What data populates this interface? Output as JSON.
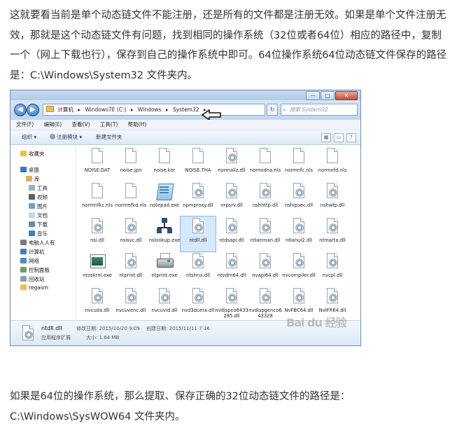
{
  "article": {
    "para1": "这就要看当前是单个动态链文件不能注册，还是所有的文件都是注册无效。如果是单个文件注册无效，那就是这个动态链文件有问题，找到相同的操作系统（32位或者64位）相应的路径中，复制一个（网上下载也行），保存到自己的操作系统中即可。64位操作系统64位动态链文件保存的路径是：C:\\Windows\\System32 文件夹内。",
    "para2": "如果是64位的操作系统，那么提取、保存正确的32位动态链文件的路径是：C:\\Windows\\SysWOW64 文件夹内。"
  },
  "explorer": {
    "window_buttons": [
      "—",
      "□",
      "✕"
    ],
    "nav": {
      "back": "◀",
      "forward": "▶"
    },
    "address": [
      "计算机",
      "▸",
      "Windows7E (C:)",
      "▸",
      "Windows",
      "▸",
      "System32",
      "▸"
    ],
    "refresh_symbol": "↻",
    "search_placeholder": "搜索 System32",
    "search_icon": "⌕",
    "menu": [
      "文件(F)",
      "编辑(E)",
      "查看(V)",
      "工具(T)",
      "帮助(H)"
    ],
    "commands": {
      "organize": "组织 ▾",
      "register": "注册模块 ▾",
      "new_folder": "新建文件夹"
    },
    "view_icons": [
      "▦",
      "▭",
      "?"
    ],
    "sidebar": [
      {
        "label": "收藏夹",
        "color": "#f0c040"
      },
      {
        "label": "桌面",
        "color": "#3a78c0"
      },
      {
        "label": "库",
        "color": "#d9b25c"
      },
      {
        "label": "工具",
        "color": "#9ab0c8"
      },
      {
        "label": "视频",
        "color": "#555e6a"
      },
      {
        "label": "图片",
        "color": "#6ea0d0"
      },
      {
        "label": "文档",
        "color": "#c8d4e0"
      },
      {
        "label": "下载",
        "color": "#5c8cc8"
      },
      {
        "label": "音乐",
        "color": "#3f7cc8"
      },
      {
        "label": "电脑人人有",
        "color": "#7a7a7a"
      },
      {
        "label": "计算机",
        "color": "#4a7cb8"
      },
      {
        "label": "网络",
        "color": "#4a8ad0"
      },
      {
        "label": "控制面板",
        "color": "#6ba060"
      },
      {
        "label": "回收站",
        "color": "#8aa0b4"
      },
      {
        "label": "regasm",
        "color": "#e8c060"
      }
    ],
    "files": [
      {
        "name": "NOISE.DAT",
        "kind": "page"
      },
      {
        "name": "noise.jpn",
        "kind": "page"
      },
      {
        "name": "noise.kor",
        "kind": "page"
      },
      {
        "name": "NOISE.THA",
        "kind": "page"
      },
      {
        "name": "normaliz.dll",
        "kind": "dll"
      },
      {
        "name": "normidna.nls",
        "kind": "page"
      },
      {
        "name": "normnfc.nls",
        "kind": "page"
      },
      {
        "name": "normnfd.nls",
        "kind": "page"
      },
      {
        "name": "normnfkc.nls",
        "kind": "page"
      },
      {
        "name": "normnfkd.nls",
        "kind": "page"
      },
      {
        "name": "notepad.exe",
        "kind": "notepad"
      },
      {
        "name": "npmproxy.dll",
        "kind": "dll"
      },
      {
        "name": "nrpsrv.dll",
        "kind": "dll"
      },
      {
        "name": "nshhttp.dll",
        "kind": "dll"
      },
      {
        "name": "nshipsec.dll",
        "kind": "dll"
      },
      {
        "name": "nshwfp.dll",
        "kind": "dll"
      },
      {
        "name": "nsi.dll",
        "kind": "dll"
      },
      {
        "name": "nsisvc.dll",
        "kind": "dll"
      },
      {
        "name": "nslookup.exe",
        "kind": "network"
      },
      {
        "name": "ntdll.dll",
        "kind": "dll",
        "selected": true
      },
      {
        "name": "ntdsapi.dll",
        "kind": "dll"
      },
      {
        "name": "ntlanman.dll",
        "kind": "dll"
      },
      {
        "name": "ntlanui2.dll",
        "kind": "dll"
      },
      {
        "name": "ntmarta.dll",
        "kind": "dll"
      },
      {
        "name": "ntoskrnl.exe",
        "kind": "app"
      },
      {
        "name": "ntprint.dll",
        "kind": "dll"
      },
      {
        "name": "ntprint.exe",
        "kind": "printer"
      },
      {
        "name": "ntshrui.dll",
        "kind": "dll"
      },
      {
        "name": "ntvdm64.dll",
        "kind": "dll"
      },
      {
        "name": "nvapi64.dll",
        "kind": "dll"
      },
      {
        "name": "nvcompiler.dll",
        "kind": "dll"
      },
      {
        "name": "nvcpl.dll",
        "kind": "dll"
      },
      {
        "name": "nvcuda.dll",
        "kind": "dll"
      },
      {
        "name": "nvcuvenc.dll",
        "kind": "dll"
      },
      {
        "name": "nvcuvid.dll",
        "kind": "dll"
      },
      {
        "name": "nvd3dumx.dll",
        "kind": "dll"
      },
      {
        "name": "nvdispco6433285.dll",
        "kind": "dll"
      },
      {
        "name": "nvdispgenco643328",
        "kind": "dll"
      },
      {
        "name": "NvFBC64.dll",
        "kind": "dll"
      },
      {
        "name": "NvIFR64.dll",
        "kind": "dll"
      }
    ],
    "details": {
      "name": "ntdll.dll",
      "type": "应用程序扩展",
      "modified": "修改日期: 2015/10/20 9:09",
      "created": "创建日期: 2015/11/11 7:16",
      "size": "大小: 1.64 MB"
    },
    "watermark": "Bai du 经验"
  }
}
